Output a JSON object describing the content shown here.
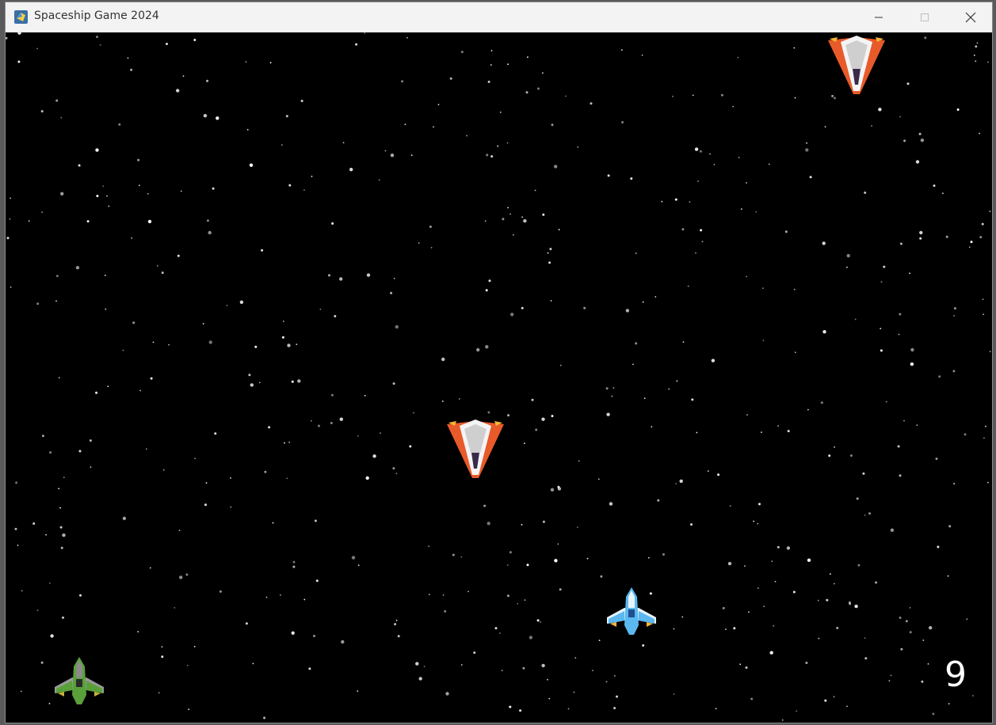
{
  "window": {
    "title": "Spaceship Game 2024",
    "app_icon": "python-icon",
    "controls": [
      "minimize-icon",
      "maximize-icon",
      "close-icon"
    ]
  },
  "game": {
    "score": "9",
    "background": "starfield",
    "sprites": [
      {
        "kind": "enemy-ship",
        "icon": "enemy-ship-icon",
        "colors": [
          "#e85a2a",
          "#e6e6e6",
          "#3a2a4a"
        ]
      },
      {
        "kind": "enemy-ship",
        "icon": "enemy-ship-icon",
        "colors": [
          "#e85a2a",
          "#e6e6e6",
          "#3a2a4a"
        ]
      },
      {
        "kind": "player-ship",
        "icon": "player-ship-icon",
        "colors": [
          "#5bb8f0",
          "#e8f4fb",
          "#1f4f8f"
        ]
      },
      {
        "kind": "life-ship",
        "icon": "life-ship-icon",
        "colors": [
          "#5aa03a",
          "#9a9a9a",
          "#2a2a2a"
        ]
      }
    ]
  }
}
